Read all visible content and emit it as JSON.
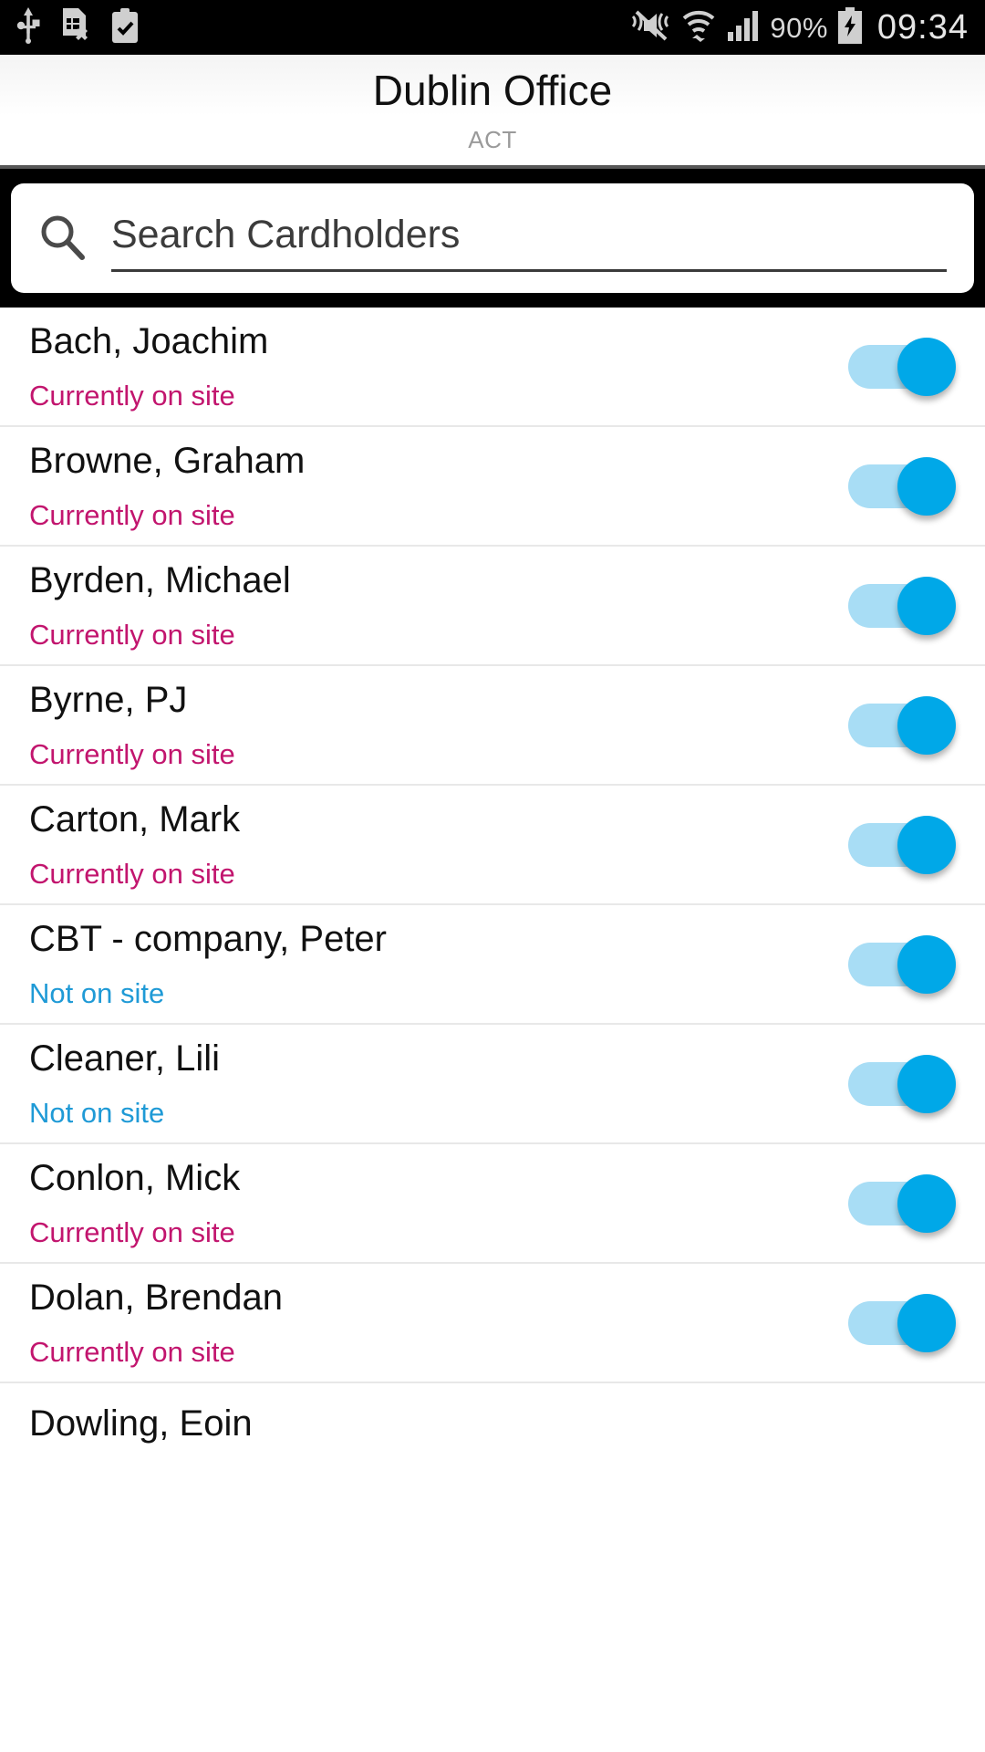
{
  "statusbar": {
    "icons_left": [
      "usb-icon",
      "sim-card-removed-icon",
      "clipboard-check-icon"
    ],
    "icons_right": [
      "mute-vibrate-icon",
      "wifi-icon",
      "signal-icon"
    ],
    "battery_percent": "90%",
    "battery_icon": "battery-charging-icon",
    "clock": "09:34"
  },
  "header": {
    "title": "Dublin Office",
    "subtitle": "ACT"
  },
  "search": {
    "icon": "search-icon",
    "placeholder": "Search Cardholders",
    "value": ""
  },
  "colors": {
    "on_site": "#c2156e",
    "off_site": "#1f9ad6",
    "toggle_thumb": "#00a8e8",
    "toggle_track": "#a8ddf5",
    "band": "#000000"
  },
  "list": {
    "rows": [
      {
        "name": "Bach, Joachim",
        "status": "Currently on site",
        "status_state": "on",
        "toggle": "on"
      },
      {
        "name": "Browne, Graham",
        "status": "Currently on site",
        "status_state": "on",
        "toggle": "on"
      },
      {
        "name": "Byrden, Michael",
        "status": "Currently on site",
        "status_state": "on",
        "toggle": "on"
      },
      {
        "name": "Byrne, PJ",
        "status": "Currently on site",
        "status_state": "on",
        "toggle": "on"
      },
      {
        "name": "Carton, Mark",
        "status": "Currently on site",
        "status_state": "on",
        "toggle": "on"
      },
      {
        "name": "CBT - company, Peter",
        "status": "Not on site",
        "status_state": "off",
        "toggle": "on"
      },
      {
        "name": "Cleaner, Lili",
        "status": "Not on site",
        "status_state": "off",
        "toggle": "on"
      },
      {
        "name": "Conlon, Mick",
        "status": "Currently on site",
        "status_state": "on",
        "toggle": "on"
      },
      {
        "name": "Dolan, Brendan",
        "status": "Currently on site",
        "status_state": "on",
        "toggle": "on"
      }
    ],
    "partial_row": {
      "name": "Dowling, Eoin"
    }
  }
}
